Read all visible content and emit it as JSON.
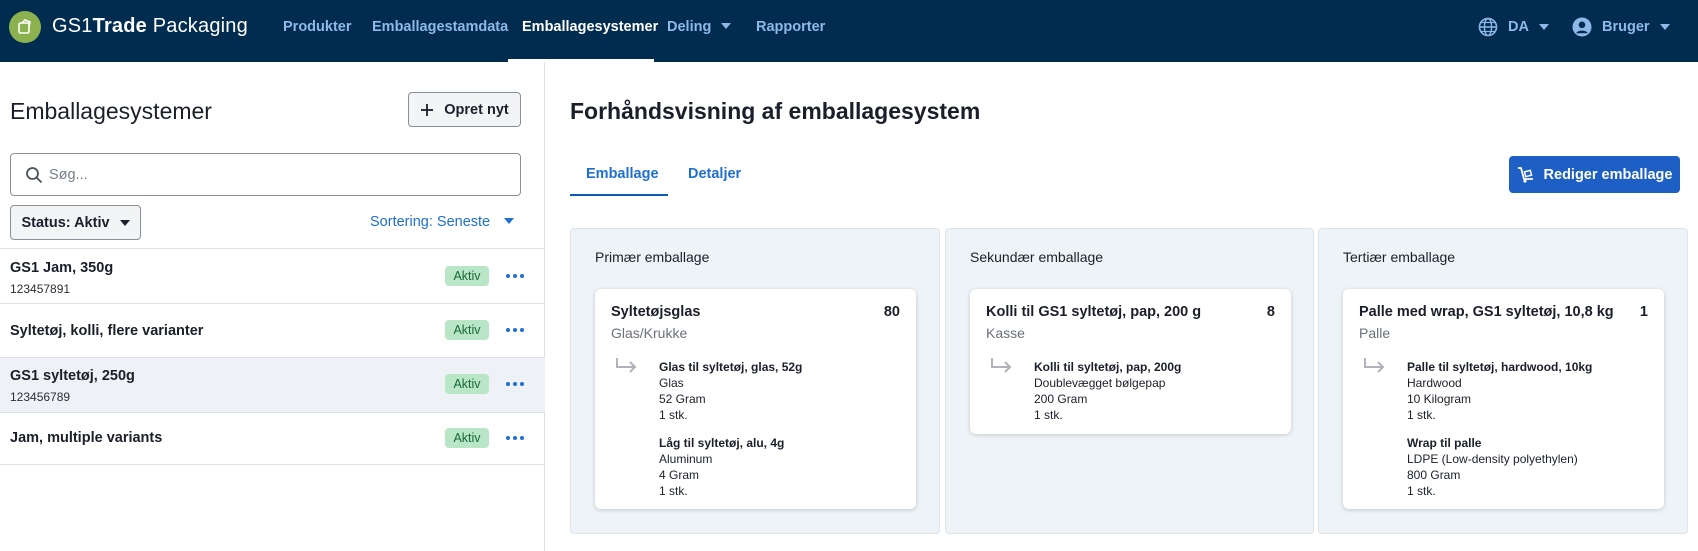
{
  "app": {
    "brand_prefix": "GS1",
    "brand_bold": "Trade",
    "brand_suffix": " Packaging"
  },
  "nav": {
    "items": [
      {
        "label": "Produkter"
      },
      {
        "label": "Emballagestamdata"
      },
      {
        "label": "Emballagesystemer"
      },
      {
        "label": "Deling"
      },
      {
        "label": "Rapporter"
      }
    ],
    "active": "Emballagesystemer",
    "language": "DA",
    "user": "Bruger"
  },
  "sidebar": {
    "title": "Emballagesystemer",
    "create_label": "Opret nyt",
    "search_placeholder": "Søg...",
    "status_filter": "Status: Aktiv",
    "sort_label": "Sortering: Seneste",
    "items": [
      {
        "title": "GS1 Jam, 350g",
        "gtin": "123457891",
        "status": "Aktiv"
      },
      {
        "title": "Syltetøj, kolli, flere varianter",
        "gtin": "",
        "status": "Aktiv"
      },
      {
        "title": "GS1 syltetøj, 250g",
        "gtin": "123456789",
        "status": "Aktiv"
      },
      {
        "title": "Jam, multiple variants",
        "gtin": "",
        "status": "Aktiv"
      }
    ]
  },
  "preview": {
    "title": "Forhåndsvisning af emballagesystem",
    "tabs": [
      {
        "label": "Emballage"
      },
      {
        "label": "Detaljer"
      }
    ],
    "edit_label": "Rediger emballage",
    "columns": [
      {
        "title": "Primær emballage",
        "card": {
          "name": "Syltetøjsglas",
          "qty": "80",
          "type": "Glas/Krukke",
          "components": [
            {
              "name": "Glas til syltetøj, glas, 52g",
              "material": "Glas",
              "weight": "52 Gram",
              "count": "1 stk."
            },
            {
              "name": "Låg til syltetøj, alu, 4g",
              "material": "Aluminum",
              "weight": "4 Gram",
              "count": "1 stk."
            }
          ]
        }
      },
      {
        "title": "Sekundær emballage",
        "card": {
          "name": "Kolli til GS1 syltetøj, pap, 200 g",
          "qty": "8",
          "type": "Kasse",
          "components": [
            {
              "name": "Kolli til syltetøj, pap, 200g",
              "material": "Doublevægget bølgepap",
              "weight": "200 Gram",
              "count": "1 stk."
            }
          ]
        }
      },
      {
        "title": "Tertiær emballage",
        "card": {
          "name": "Palle med wrap, GS1 syltetøj, 10,8 kg",
          "qty": "1",
          "type": "Palle",
          "components": [
            {
              "name": "Palle til syltetøj, hardwood, 10kg",
              "material": "Hardwood",
              "weight": "10 Kilogram",
              "count": "1 stk."
            },
            {
              "name": "Wrap til palle",
              "material": "LDPE (Low-density polyethylen)",
              "weight": "800 Gram",
              "count": "1 stk."
            }
          ]
        }
      }
    ]
  },
  "colors": {
    "nav_bg": "#002c4f",
    "nav_link": "#8fb8e8",
    "accent": "#1d5fc4",
    "badge_bg": "#b9e6c7",
    "badge_text": "#19693a",
    "column_bg": "#eef3f8",
    "logo": "#8bb24f"
  },
  "icons": {
    "logo": "gs1-leaf-logo",
    "language": "globe-icon",
    "user": "user-circle-icon",
    "create": "plus-icon",
    "search": "search-icon",
    "edit": "dolly-icon",
    "component": "arrow-return-icon",
    "more": "ellipsis-icon"
  }
}
